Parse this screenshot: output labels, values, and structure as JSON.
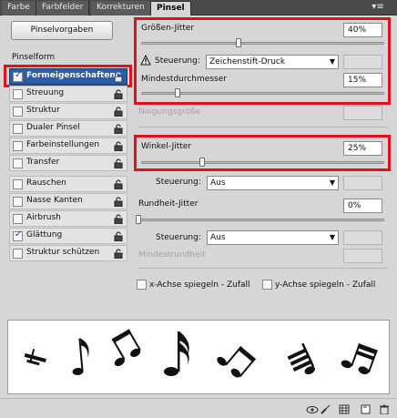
{
  "tabs": [
    "Farbe",
    "Farbfelder",
    "Korrekturen",
    "Pinsel"
  ],
  "panel_menu_icon": "panel-menu-icon",
  "preset_button": "Pinselvorgaben",
  "sidebar": {
    "header": "Pinselform",
    "items": [
      {
        "label": "Formeigenschaften",
        "checked": true,
        "selected": true
      },
      {
        "label": "Streuung",
        "checked": false
      },
      {
        "label": "Struktur",
        "checked": false
      },
      {
        "label": "Dualer Pinsel",
        "checked": false
      },
      {
        "label": "Farbeinstellungen",
        "checked": false
      },
      {
        "label": "Transfer",
        "checked": false
      },
      {
        "label": "Rauschen",
        "checked": false
      },
      {
        "label": "Nasse Kanten",
        "checked": false
      },
      {
        "label": "Airbrush",
        "checked": false
      },
      {
        "label": "Glättung",
        "checked": true
      },
      {
        "label": "Struktur schützen",
        "checked": false
      }
    ]
  },
  "size_jitter": {
    "label": "Größen-Jitter",
    "value": "40%",
    "level": 0.4
  },
  "control_1": {
    "label": "Steuerung:",
    "value": "Zeichenstift-Druck",
    "warning_icon": "warning-icon"
  },
  "min_diameter": {
    "label": "Mindestdurchmesser",
    "value": "15%",
    "level": 0.15
  },
  "tilt_scale": {
    "label": "Neigungsgröße"
  },
  "angle_jitter": {
    "label": "Winkel-Jitter",
    "value": "25%",
    "level": 0.25
  },
  "control_2": {
    "label": "Steuerung:",
    "value": "Aus"
  },
  "roundness_jitter": {
    "label": "Rundheit-Jitter",
    "value": "0%",
    "level": 0.0
  },
  "control_3": {
    "label": "Steuerung:",
    "value": "Aus"
  },
  "min_roundness": {
    "label": "Mindestrundheit"
  },
  "flip_x": {
    "label": "x-Achse spiegeln - Zufall",
    "checked": false
  },
  "flip_y": {
    "label": "y-Achse spiegeln - Zufall",
    "checked": false
  },
  "colors": {
    "highlight": "#e0111f",
    "selection": "#2a5ca7"
  }
}
